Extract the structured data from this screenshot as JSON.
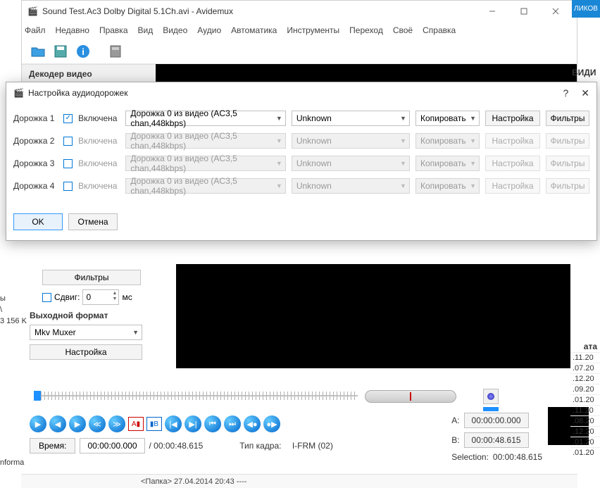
{
  "window": {
    "title": "Sound Test.Ac3 Dolby Digital 5.1Ch.avi - Avidemux",
    "decoder_label": "Декодер видео"
  },
  "menu": {
    "file": "Файл",
    "recent": "Недавно",
    "edit": "Правка",
    "view": "Вид",
    "video": "Видео",
    "audio": "Аудио",
    "auto": "Автоматика",
    "tools": "Инструменты",
    "go": "Переход",
    "custom": "Своё",
    "help": "Справка"
  },
  "dialog": {
    "title": "Настройка аудиодорожек",
    "track_prefix": "Дорожка",
    "enabled": "Включена",
    "source": "Дорожка 0 из видео (AC3,5 chan,448kbps)",
    "lang": "Unknown",
    "codec": "Копировать",
    "setup": "Настройка",
    "filters": "Фильтры",
    "ok": "OK",
    "cancel": "Отмена",
    "tracks": [
      {
        "num": "1",
        "checked": true
      },
      {
        "num": "2",
        "checked": false
      },
      {
        "num": "3",
        "checked": false
      },
      {
        "num": "4",
        "checked": false
      }
    ]
  },
  "lower": {
    "filters": "Фильтры",
    "shift": "Сдвиг:",
    "shift_val": "0",
    "ms": "мс",
    "out_format": "Выходной формат",
    "format": "Mkv Muxer",
    "setup": "Настройка"
  },
  "timeline": {
    "a_label": "A:",
    "a_val": "00:00:00.000",
    "b_label": "B:",
    "b_val": "00:00:48.615",
    "sel_label": "Selection:",
    "sel_val": "00:00:48.615",
    "time_label": "Время:",
    "time_val": "00:00:00.000",
    "dur": "/ 00:00:48.615",
    "frame_type_label": "Тип кадра:",
    "frame_type": "I-FRM (02)"
  },
  "status": {
    "text": "<Папка> 27.04.2014 20:43 ----"
  },
  "side": {
    "top": "ЛИКОВ",
    "vid": "ВИДИ",
    "head": "ата",
    "dates": [
      ".11.20",
      ".07.20",
      ".12.20",
      ".09.20",
      ".01.20",
      ".11.20",
      ".08.20",
      ".12.20",
      ".01.20",
      ".01.20"
    ]
  },
  "left_frag": {
    "l1": "ы",
    "l2": "\\",
    "l3": "3 156 K",
    "bottom": "nforma"
  }
}
